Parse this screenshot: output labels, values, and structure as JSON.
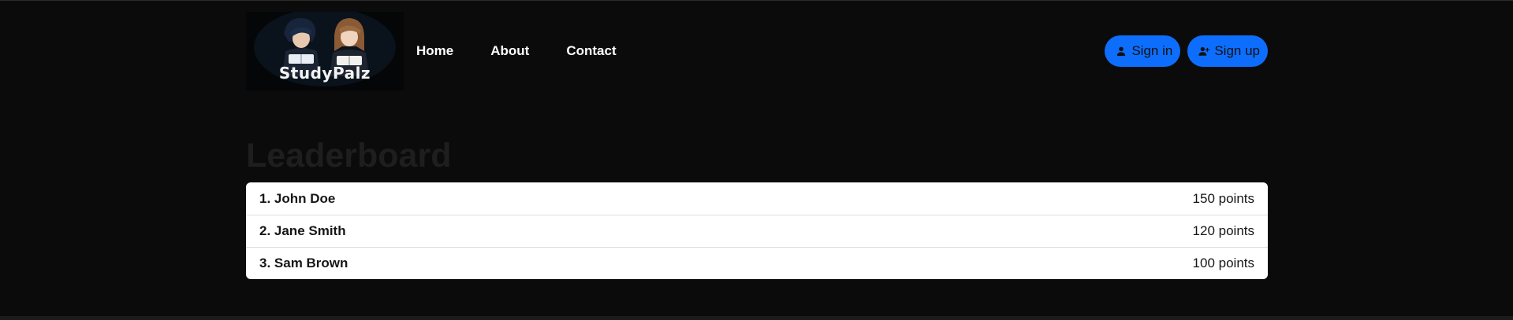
{
  "brand": {
    "logo_text": "StudyPalz"
  },
  "nav": {
    "links": [
      {
        "label": "Home"
      },
      {
        "label": "About"
      },
      {
        "label": "Contact"
      }
    ]
  },
  "auth": {
    "sign_in_label": "Sign in",
    "sign_up_label": "Sign up"
  },
  "leaderboard": {
    "title": "Leaderboard",
    "entries": [
      {
        "name": "1. John Doe",
        "points": "150 points"
      },
      {
        "name": "2. Jane Smith",
        "points": "120 points"
      },
      {
        "name": "3. Sam Brown",
        "points": "100 points"
      }
    ]
  },
  "colors": {
    "background": "#0b0b0b",
    "accent": "#0d6efd",
    "card": "#ffffff"
  },
  "icons": {
    "sign_in": "person-icon",
    "sign_up": "person-add-icon"
  }
}
